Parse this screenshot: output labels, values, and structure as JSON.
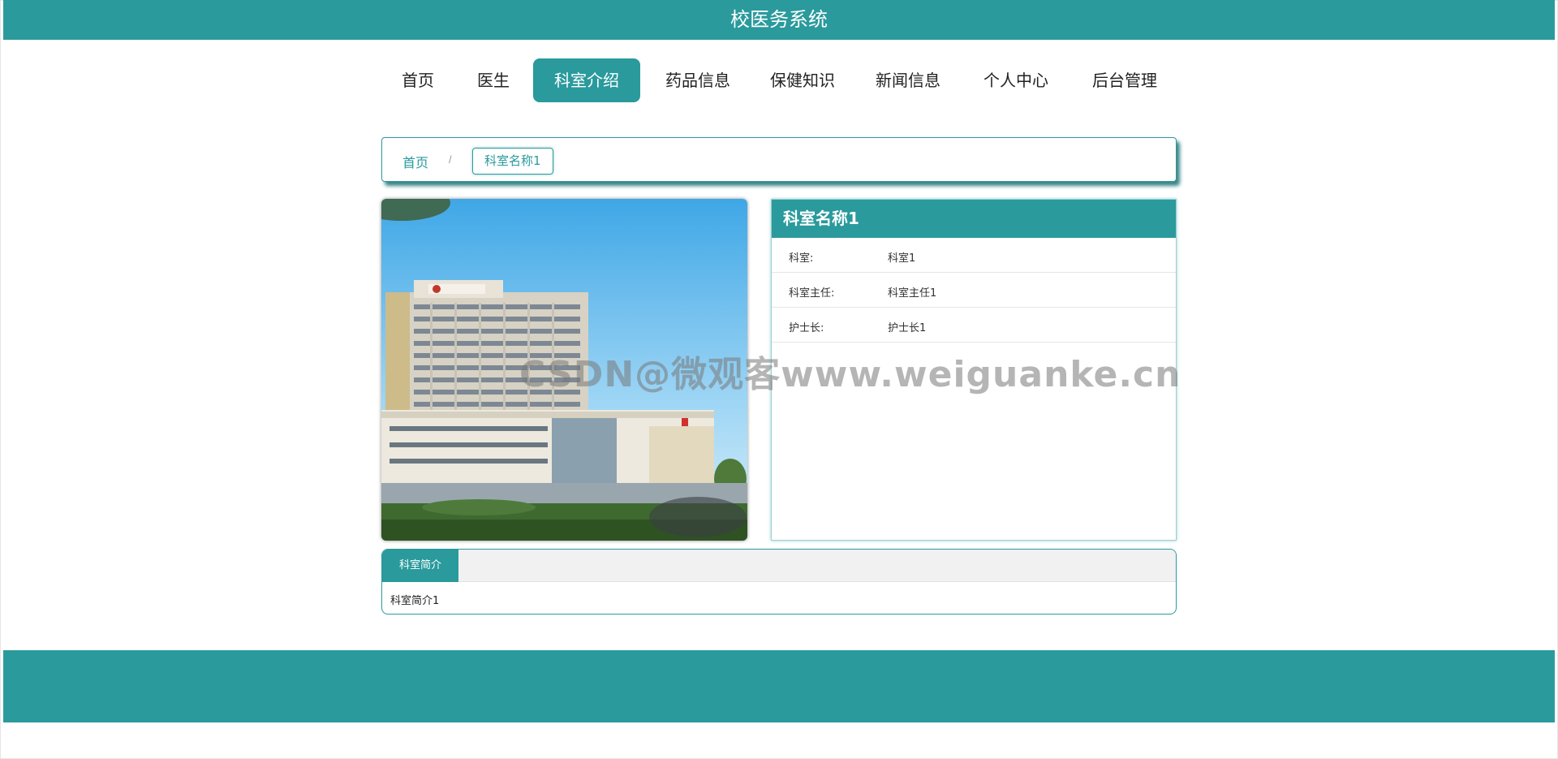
{
  "header": {
    "title": "校医务系统"
  },
  "nav": {
    "items": [
      {
        "label": "首页"
      },
      {
        "label": "医生"
      },
      {
        "label": "科室介绍"
      },
      {
        "label": "药品信息"
      },
      {
        "label": "保健知识"
      },
      {
        "label": "新闻信息"
      },
      {
        "label": "个人中心"
      },
      {
        "label": "后台管理"
      }
    ],
    "active": "科室介绍"
  },
  "breadcrumb": {
    "home": "首页",
    "separator": "/",
    "current": "科室名称1"
  },
  "detail": {
    "title": "科室名称1",
    "rows": [
      {
        "label": "科室:",
        "value": "科室1"
      },
      {
        "label": "科室主任:",
        "value": "科室主任1"
      },
      {
        "label": "护士长:",
        "value": "护士长1"
      }
    ]
  },
  "watermark": "CSDN@微观客www.weiguanke.cn",
  "tabs": {
    "active_label": "科室简介",
    "content": "科室简介1"
  },
  "colors": {
    "primary": "#2a9a9c",
    "tab_bar": "#f1f1f1"
  }
}
